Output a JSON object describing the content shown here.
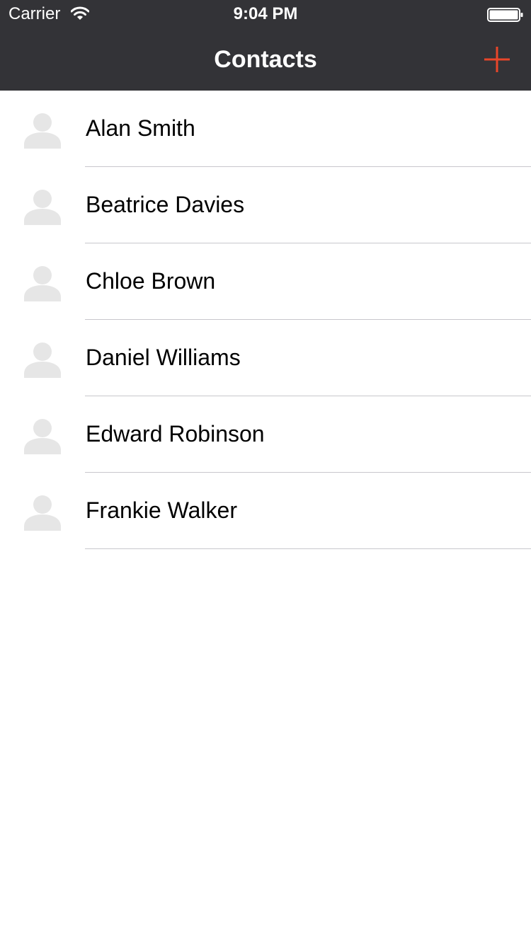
{
  "status_bar": {
    "carrier": "Carrier",
    "time": "9:04 PM"
  },
  "nav": {
    "title": "Contacts",
    "add_icon": "plus-icon",
    "accent_color": "#e8462a"
  },
  "contacts": [
    {
      "name": "Alan Smith"
    },
    {
      "name": "Beatrice Davies"
    },
    {
      "name": "Chloe Brown"
    },
    {
      "name": "Daniel Williams"
    },
    {
      "name": "Edward Robinson"
    },
    {
      "name": "Frankie Walker"
    }
  ],
  "colors": {
    "navbar_background": "#333337",
    "avatar_placeholder": "#e6e6e6",
    "separator": "#c8c7cc"
  }
}
